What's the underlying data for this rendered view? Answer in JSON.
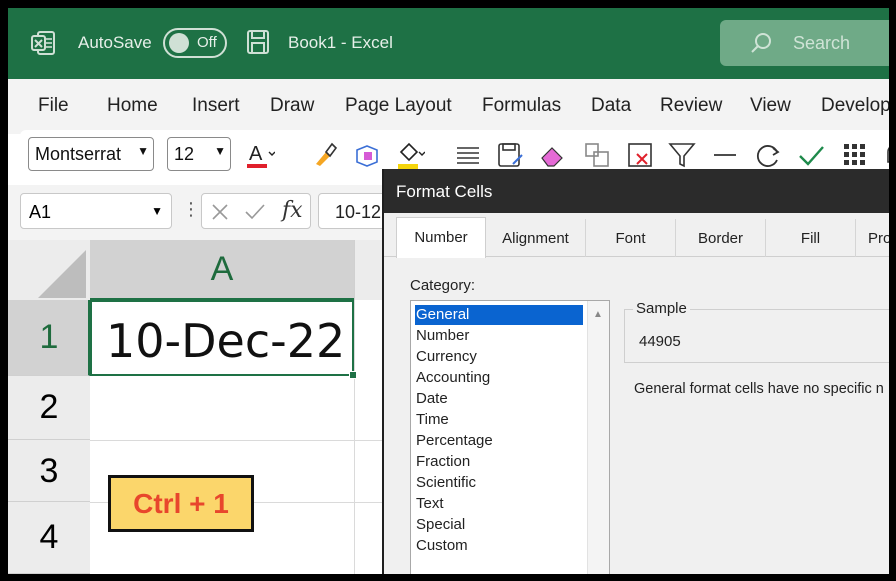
{
  "titlebar": {
    "autosave_label": "AutoSave",
    "autosave_state": "Off",
    "doc_title": "Book1  -  Excel",
    "search_placeholder": "Search"
  },
  "menu": {
    "tabs": [
      "File",
      "Home",
      "Insert",
      "Draw",
      "Page Layout",
      "Formulas",
      "Data",
      "Review",
      "View",
      "Develop"
    ]
  },
  "ribbon": {
    "font_name": "Montserrat",
    "font_size": "12",
    "icons": [
      "font-color-icon",
      "format-painter-icon",
      "cell-styles-icon",
      "fill-color-icon",
      "align-icon",
      "save-as-icon",
      "eraser-icon",
      "copy-format-icon",
      "delete-cells-icon",
      "filter-icon",
      "minus-icon",
      "refresh-icon",
      "checkmark-icon",
      "grid-icon",
      "notification-icon"
    ],
    "font_color_bar": "#e0202b",
    "fill_color_bar": "#f5d50b"
  },
  "formula_bar": {
    "name_box": "A1",
    "fx_label": "fx",
    "formula_value": "10-12"
  },
  "grid": {
    "column_header": "A",
    "rows": [
      "1",
      "2",
      "3",
      "4"
    ],
    "cell_a1": "10-Dec-22",
    "shortcut_badge": "Ctrl + 1"
  },
  "dialog": {
    "title": "Format Cells",
    "tabs": [
      "Number",
      "Alignment",
      "Font",
      "Border",
      "Fill",
      "Pro"
    ],
    "active_tab": "Number",
    "category_label": "Category:",
    "categories": [
      "General",
      "Number",
      "Currency",
      "Accounting",
      "Date",
      "Time",
      "Percentage",
      "Fraction",
      "Scientific",
      "Text",
      "Special",
      "Custom"
    ],
    "selected_category": "General",
    "sample_label": "Sample",
    "sample_value": "44905",
    "description": "General format cells have no specific n"
  },
  "colors": {
    "excel_green": "#1e7145",
    "selection_blue": "#0a64d0",
    "badge_fill": "#fbd66b",
    "badge_text": "#e8462c"
  }
}
